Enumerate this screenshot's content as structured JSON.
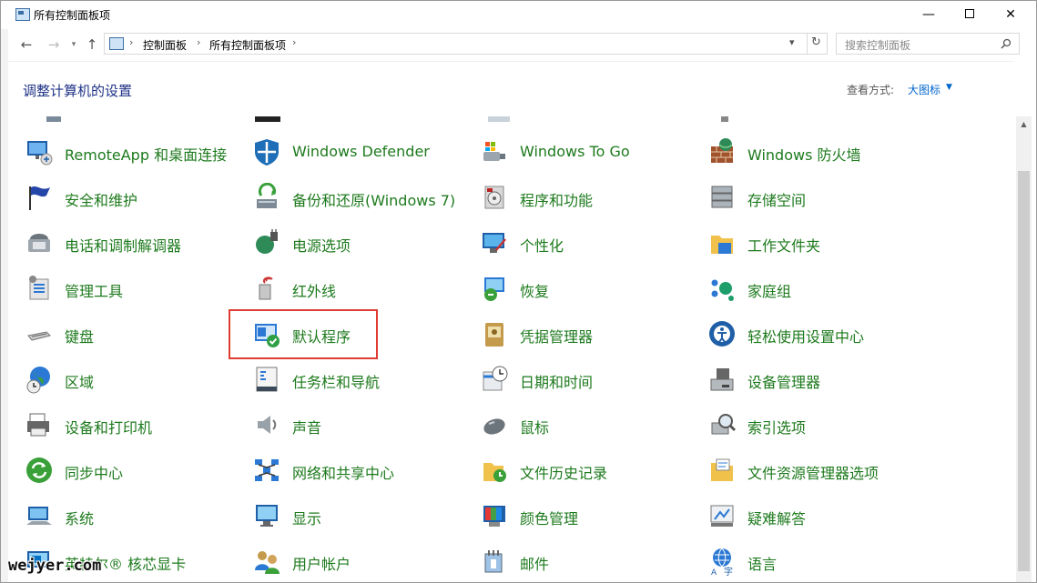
{
  "window": {
    "title": "所有控制面板项",
    "controls": {
      "minimize": "—",
      "maximize": "",
      "close": "✕"
    }
  },
  "nav": {
    "back": "←",
    "forward": "→",
    "dropdown": "▾",
    "up": "↑",
    "breadcrumb": [
      "控制面板",
      "所有控制面板项"
    ],
    "separator": "›",
    "refresh": "↻",
    "search_placeholder": "搜索控制面板"
  },
  "header": {
    "title": "调整计算机的设置",
    "view_by_label": "查看方式:",
    "view_by_value": "大图标"
  },
  "items": [
    {
      "label": "RemoteApp 和桌面连接",
      "icon": "remote-desktop-icon"
    },
    {
      "label": "Windows Defender",
      "icon": "shield-icon"
    },
    {
      "label": "Windows To Go",
      "icon": "usb-drive-icon"
    },
    {
      "label": "Windows 防火墙",
      "icon": "firewall-icon"
    },
    {
      "label": "安全和维护",
      "icon": "flag-icon"
    },
    {
      "label": "备份和还原(Windows 7)",
      "icon": "backup-icon"
    },
    {
      "label": "程序和功能",
      "icon": "programs-icon"
    },
    {
      "label": "存储空间",
      "icon": "storage-icon"
    },
    {
      "label": "电话和调制解调器",
      "icon": "phone-icon"
    },
    {
      "label": "电源选项",
      "icon": "power-icon"
    },
    {
      "label": "个性化",
      "icon": "personalize-icon"
    },
    {
      "label": "工作文件夹",
      "icon": "work-folder-icon"
    },
    {
      "label": "管理工具",
      "icon": "admin-tools-icon"
    },
    {
      "label": "红外线",
      "icon": "infrared-icon"
    },
    {
      "label": "恢复",
      "icon": "recovery-icon"
    },
    {
      "label": "家庭组",
      "icon": "homegroup-icon"
    },
    {
      "label": "键盘",
      "icon": "keyboard-icon"
    },
    {
      "label": "默认程序",
      "icon": "default-programs-icon"
    },
    {
      "label": "凭据管理器",
      "icon": "credential-icon"
    },
    {
      "label": "轻松使用设置中心",
      "icon": "ease-of-access-icon"
    },
    {
      "label": "区域",
      "icon": "region-icon"
    },
    {
      "label": "任务栏和导航",
      "icon": "taskbar-icon"
    },
    {
      "label": "日期和时间",
      "icon": "datetime-icon"
    },
    {
      "label": "设备管理器",
      "icon": "device-manager-icon"
    },
    {
      "label": "设备和打印机",
      "icon": "printer-icon"
    },
    {
      "label": "声音",
      "icon": "sound-icon"
    },
    {
      "label": "鼠标",
      "icon": "mouse-icon"
    },
    {
      "label": "索引选项",
      "icon": "indexing-icon"
    },
    {
      "label": "同步中心",
      "icon": "sync-icon"
    },
    {
      "label": "网络和共享中心",
      "icon": "network-icon"
    },
    {
      "label": "文件历史记录",
      "icon": "file-history-icon"
    },
    {
      "label": "文件资源管理器选项",
      "icon": "folder-options-icon"
    },
    {
      "label": "系统",
      "icon": "system-icon"
    },
    {
      "label": "显示",
      "icon": "display-icon"
    },
    {
      "label": "颜色管理",
      "icon": "color-icon"
    },
    {
      "label": "疑难解答",
      "icon": "troubleshoot-icon"
    },
    {
      "label": "英特尔® 核芯显卡",
      "icon": "intel-graphics-icon"
    },
    {
      "label": "用户帐户",
      "icon": "user-accounts-icon"
    },
    {
      "label": "邮件",
      "icon": "mail-icon"
    },
    {
      "label": "语言",
      "icon": "language-icon"
    }
  ],
  "highlighted_item": "默认程序",
  "watermark": "wejyer.com",
  "colors": {
    "item_text": "#1d7a1d",
    "title_text": "#1e3287",
    "link": "#0066cc",
    "highlight_border": "#e03c31"
  }
}
